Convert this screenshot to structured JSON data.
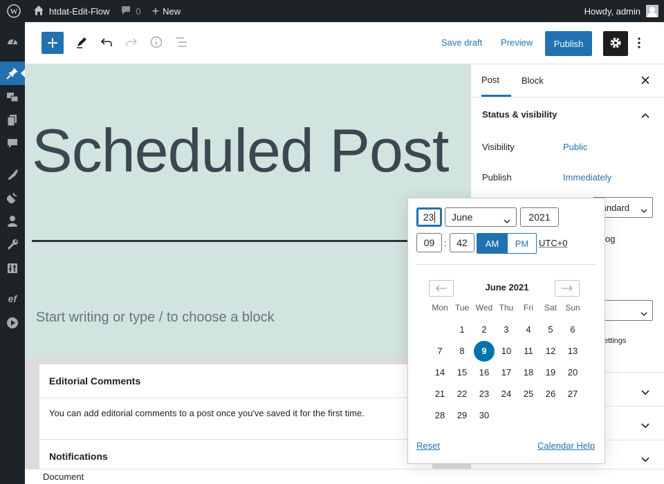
{
  "adminbar": {
    "site_name": "htdat-Edit-Flow",
    "comments_count": "0",
    "new_label": "New",
    "howdy": "Howdy, admin"
  },
  "admin_menu": {
    "icons": [
      "dashboard-icon",
      "pin-icon",
      "media-icon",
      "pages-icon",
      "comments-icon",
      "appearance-icon",
      "plugins-icon",
      "users-icon",
      "tools-icon",
      "settings-icon",
      "editflow-icon",
      "play-icon"
    ],
    "active": "pin-icon"
  },
  "header": {
    "save_draft": "Save draft",
    "preview": "Preview",
    "publish": "Publish"
  },
  "canvas": {
    "title": "Scheduled Post",
    "placeholder": "Start writing or type / to choose a block",
    "background": "#d2e4df"
  },
  "metaboxes": {
    "editorial_title": "Editorial Comments",
    "editorial_body": "You can add editorial comments to a post once you've saved it for the first time.",
    "notifications_title": "Notifications"
  },
  "footer": {
    "breadcrumb": "Document"
  },
  "sidebar": {
    "tab_post": "Post",
    "tab_block": "Block",
    "section_title": "Status & visibility",
    "visibility_label": "Visibility",
    "visibility_value": "Public",
    "publish_label": "Publish",
    "publish_value": "Immediately",
    "format_partial": "tandard",
    "sticky_partial": "og",
    "settings_partial": "ettings"
  },
  "datepicker": {
    "day": "23",
    "month": "June",
    "year": "2021",
    "hour": "09",
    "minute": "42",
    "time_sep": ":",
    "am": "AM",
    "pm": "PM",
    "am_selected": true,
    "timezone": "UTC+0",
    "calendar_title": "June 2021",
    "weekdays": [
      "Mon",
      "Tue",
      "Wed",
      "Thu",
      "Fri",
      "Sat",
      "Sun"
    ],
    "first_weekday_index": 1,
    "days_in_month": 30,
    "selected_day": 9,
    "reset": "Reset",
    "help": "Calendar Help"
  },
  "colors": {
    "accent": "#2271b1",
    "selected_day": "#0073aa",
    "admin_bar": "#1d2327"
  }
}
